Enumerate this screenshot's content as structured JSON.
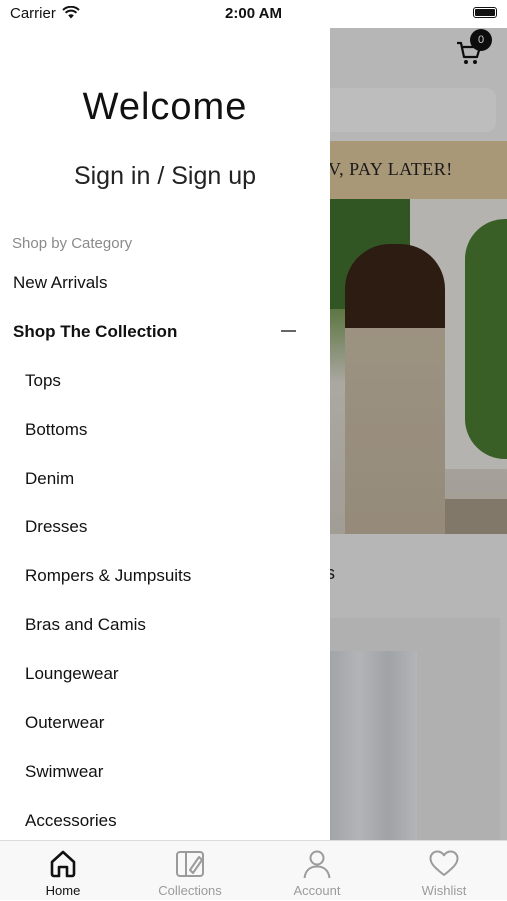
{
  "status_bar": {
    "carrier": "Carrier",
    "time": "2:00 AM"
  },
  "background": {
    "cart_count": "0",
    "banner_text": "V, PAY LATER!",
    "section_fragment": "s"
  },
  "drawer": {
    "welcome": "Welcome",
    "sign_in": "Sign in / Sign up",
    "category_heading": "Shop by Category",
    "items": [
      {
        "label": "New Arrivals"
      },
      {
        "label": "Shop The Collection"
      }
    ],
    "sub_items": [
      {
        "label": "Tops"
      },
      {
        "label": "Bottoms"
      },
      {
        "label": "Denim"
      },
      {
        "label": "Dresses"
      },
      {
        "label": "Rompers & Jumpsuits"
      },
      {
        "label": "Bras and Camis"
      },
      {
        "label": "Loungewear"
      },
      {
        "label": "Outerwear"
      },
      {
        "label": "Swimwear"
      },
      {
        "label": "Accessories"
      }
    ]
  },
  "tabs": [
    {
      "label": "Home",
      "icon": "home-icon",
      "active": true
    },
    {
      "label": "Collections",
      "icon": "collections-icon",
      "active": false
    },
    {
      "label": "Account",
      "icon": "account-icon",
      "active": false
    },
    {
      "label": "Wishlist",
      "icon": "heart-icon",
      "active": false
    }
  ]
}
